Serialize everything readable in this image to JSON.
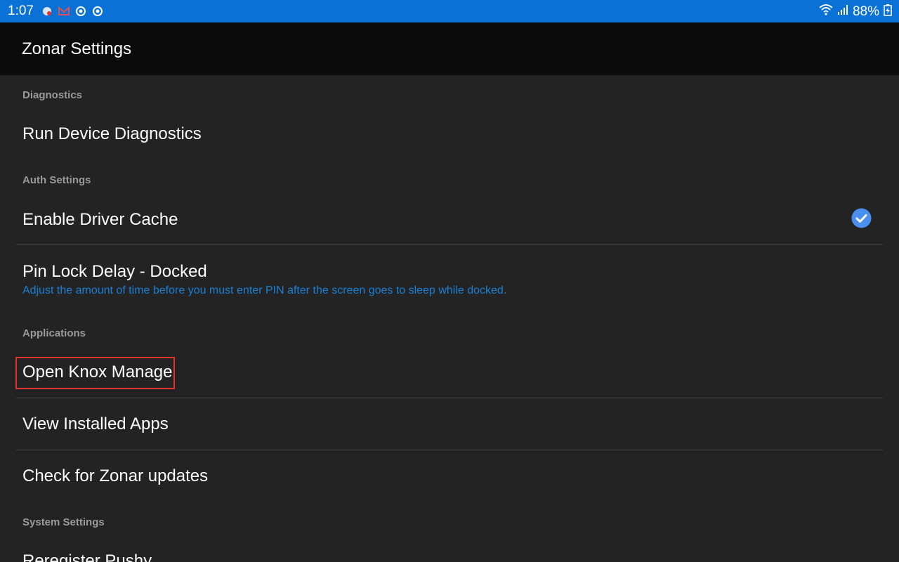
{
  "status_bar": {
    "time": "1:07",
    "battery": "88%",
    "notification_icons": [
      "app-notification-icon",
      "mail-icon",
      "sync-icon",
      "sync-icon"
    ],
    "status_icons": [
      "wifi-icon",
      "signal-icon",
      "battery-charging-icon"
    ]
  },
  "app_bar": {
    "title": "Zonar Settings"
  },
  "sections": {
    "diagnostics": {
      "header": "Diagnostics",
      "run_diagnostics": "Run Device Diagnostics"
    },
    "auth": {
      "header": "Auth Settings",
      "driver_cache": {
        "title": "Enable Driver Cache",
        "checked": true
      },
      "pin_lock": {
        "title": "Pin Lock Delay - Docked",
        "summary": "Adjust the amount of time before you must enter PIN after the screen goes to sleep while docked."
      }
    },
    "applications": {
      "header": "Applications",
      "open_knox": "Open Knox Manage",
      "view_apps": "View Installed Apps",
      "check_updates": "Check for Zonar updates"
    },
    "system": {
      "header": "System Settings",
      "reregister": "Reregister Pushy"
    }
  },
  "colors": {
    "status_bar": "#0a72d6",
    "app_bar": "#0b0b0b",
    "background": "#232323",
    "accent": "#1a7fd6",
    "check": "#4a8ff0",
    "highlight": "#e0322f"
  }
}
